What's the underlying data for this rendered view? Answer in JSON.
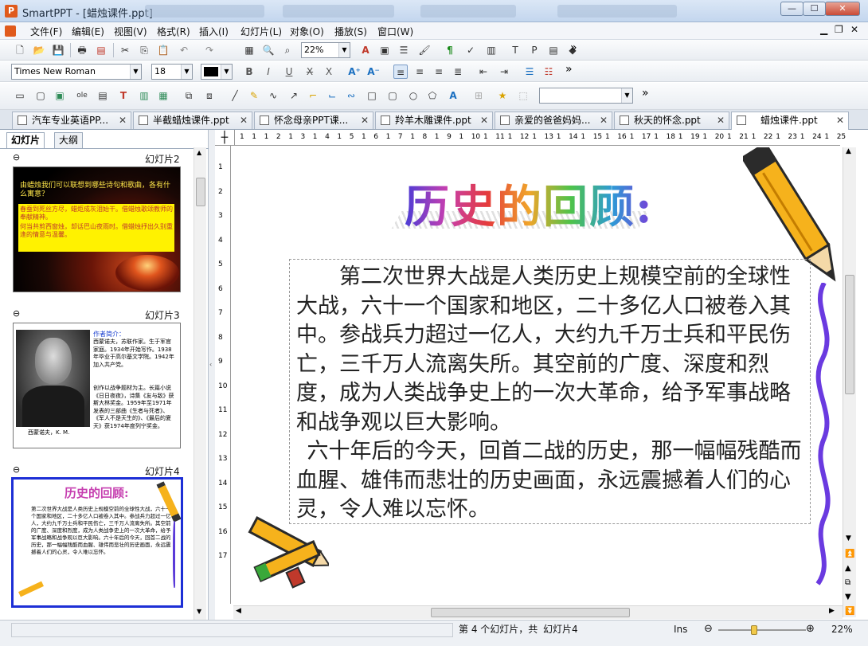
{
  "window": {
    "app_title": "SmartPPT - [蜡烛课件.ppt]",
    "app_icon": "P",
    "minimize": "—",
    "maximize": "☐",
    "close": "✕"
  },
  "menu": [
    "文件(F)",
    "编辑(E)",
    "视图(V)",
    "格式(R)",
    "插入(I)",
    "幻灯片(L)",
    "对象(O)",
    "播放(S)",
    "窗口(W)"
  ],
  "toolbar": {
    "zoom_value": "22%",
    "font_name": "Times New Roman",
    "font_size": "18",
    "more": "»"
  },
  "doc_tabs": [
    {
      "label": "汽车专业英语PP..."
    },
    {
      "label": "半截蜡烛课件.ppt"
    },
    {
      "label": "怀念母亲PPT课..."
    },
    {
      "label": "羚羊木雕课件.ppt"
    },
    {
      "label": "亲爱的爸爸妈妈..."
    },
    {
      "label": "秋天的怀念.ppt"
    },
    {
      "label": "蜡烛课件.ppt"
    }
  ],
  "left_panel": {
    "tab_slides": "幻灯片",
    "tab_outline": "大纲",
    "slides": [
      {
        "label": "幻灯片2",
        "question": "由蜡烛我们可以联想到哪些诗句和歌曲，各有什么寓意？",
        "lines": [
          "春蚕到死丝方尽，蜡炬成灰泪始干。借蜡烛歌颂教师的奉献精神。",
          "何当共剪西窗烛，却话巴山夜雨时。借蜡烛抒出久别重逢的情意与温馨。"
        ]
      },
      {
        "label": "幻灯片3",
        "heading": "作者简介：",
        "body": "西蒙诺夫，苏联作家。生于军官家庭。1934年开始写作。1938年毕业于高尔基文学院。1942年加入共产党。",
        "body2": "创作以战争题材为主。长篇小说《日日夜夜》，诗集《友与敌》获斯大林奖金。1959年至1971年发表的三部曲《生者与死者》、《军人不是天生的》、《最后的夏天》获1974年度列宁奖金。",
        "caption": "西蒙诺夫，K. M."
      },
      {
        "label": "幻灯片4",
        "title": "历史的回顾:",
        "text": "第二次世界大战是人类历史上规模空前的全球性大战，六十一个国家和地区，二十多亿人口被卷入其中。参战兵力超过一亿人，大约九千万士兵和平民伤亡，三千万人流离失所。其空前的广度、深度和烈度，成为人类战争史上的一次大革命，给予军事战略和战争观以巨大影响。六十年后的今天，回首二战的历史，那一幅幅残酷而血腥、雄伟而悲壮的历史画面，永远震撼着人们的心灵，令人难以忘怀。"
      }
    ]
  },
  "ruler": {
    "h": [
      "1",
      "1",
      "1",
      "2",
      "1",
      "3",
      "1",
      "4",
      "1",
      "5",
      "1",
      "6",
      "1",
      "7",
      "1",
      "8",
      "1",
      "9",
      "1",
      "10",
      "1",
      "11",
      "1",
      "12",
      "1",
      "13",
      "1",
      "14",
      "1",
      "15",
      "1",
      "16",
      "1",
      "17",
      "1",
      "18",
      "1",
      "19",
      "1",
      "20",
      "1",
      "21",
      "1",
      "22",
      "1",
      "23",
      "1",
      "24",
      "1",
      "25"
    ],
    "v": [
      "1",
      "2",
      "3",
      "4",
      "5",
      "6",
      "7",
      "8",
      "9",
      "10",
      "11",
      "12",
      "13",
      "14",
      "15",
      "16",
      "17"
    ]
  },
  "slide": {
    "title": "历史的回顾:",
    "paragraph1": "第二次世界大战是人类历史上规模空前的全球性大战，六十一个国家和地区，二十多亿人口被卷入其中。参战兵力超过一亿人，大约九千万士兵和平民伤亡，三千万人流离失所。其空前的广度、深度和烈度，成为人类战争史上的一次大革命，给予军事战略和战争观以巨大影响。",
    "paragraph2": "六十年后的今天，回首二战的历史，那一幅幅残酷而血腥、雄伟而悲壮的历史画面，永远震撼着人们的心灵，令人难以忘怀。"
  },
  "status": {
    "slide_count": "第 4 个幻灯片，共",
    "slide_name": "幻灯片4",
    "ins": "Ins",
    "zoom": "22%",
    "zoom_fraction": 0.4
  }
}
